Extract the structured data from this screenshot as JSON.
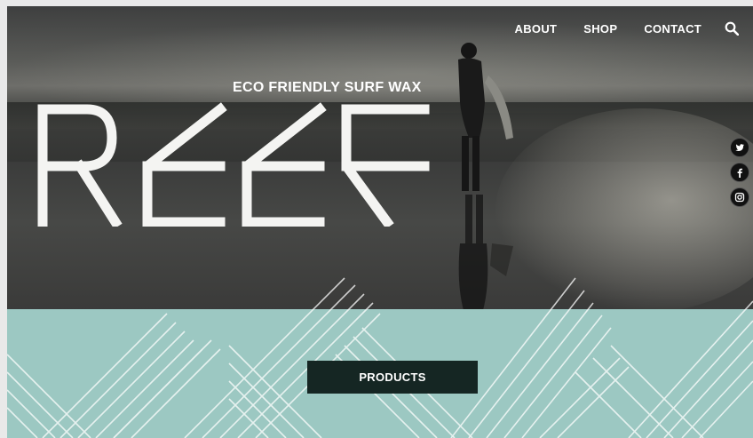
{
  "nav": {
    "items": [
      {
        "label": "ABOUT"
      },
      {
        "label": "SHOP"
      },
      {
        "label": "CONTACT"
      }
    ],
    "search_icon": "search-icon"
  },
  "hero": {
    "tagline": "ECO FRIENDLY SURF WAX",
    "logo_text": "REEF"
  },
  "social": [
    {
      "icon": "twitter-icon"
    },
    {
      "icon": "facebook-icon"
    },
    {
      "icon": "instagram-icon"
    }
  ],
  "cta": {
    "products_label": "PRODUCTS"
  },
  "colors": {
    "band": "#9cc8c2",
    "button": "#152623",
    "text": "#ffffff"
  }
}
